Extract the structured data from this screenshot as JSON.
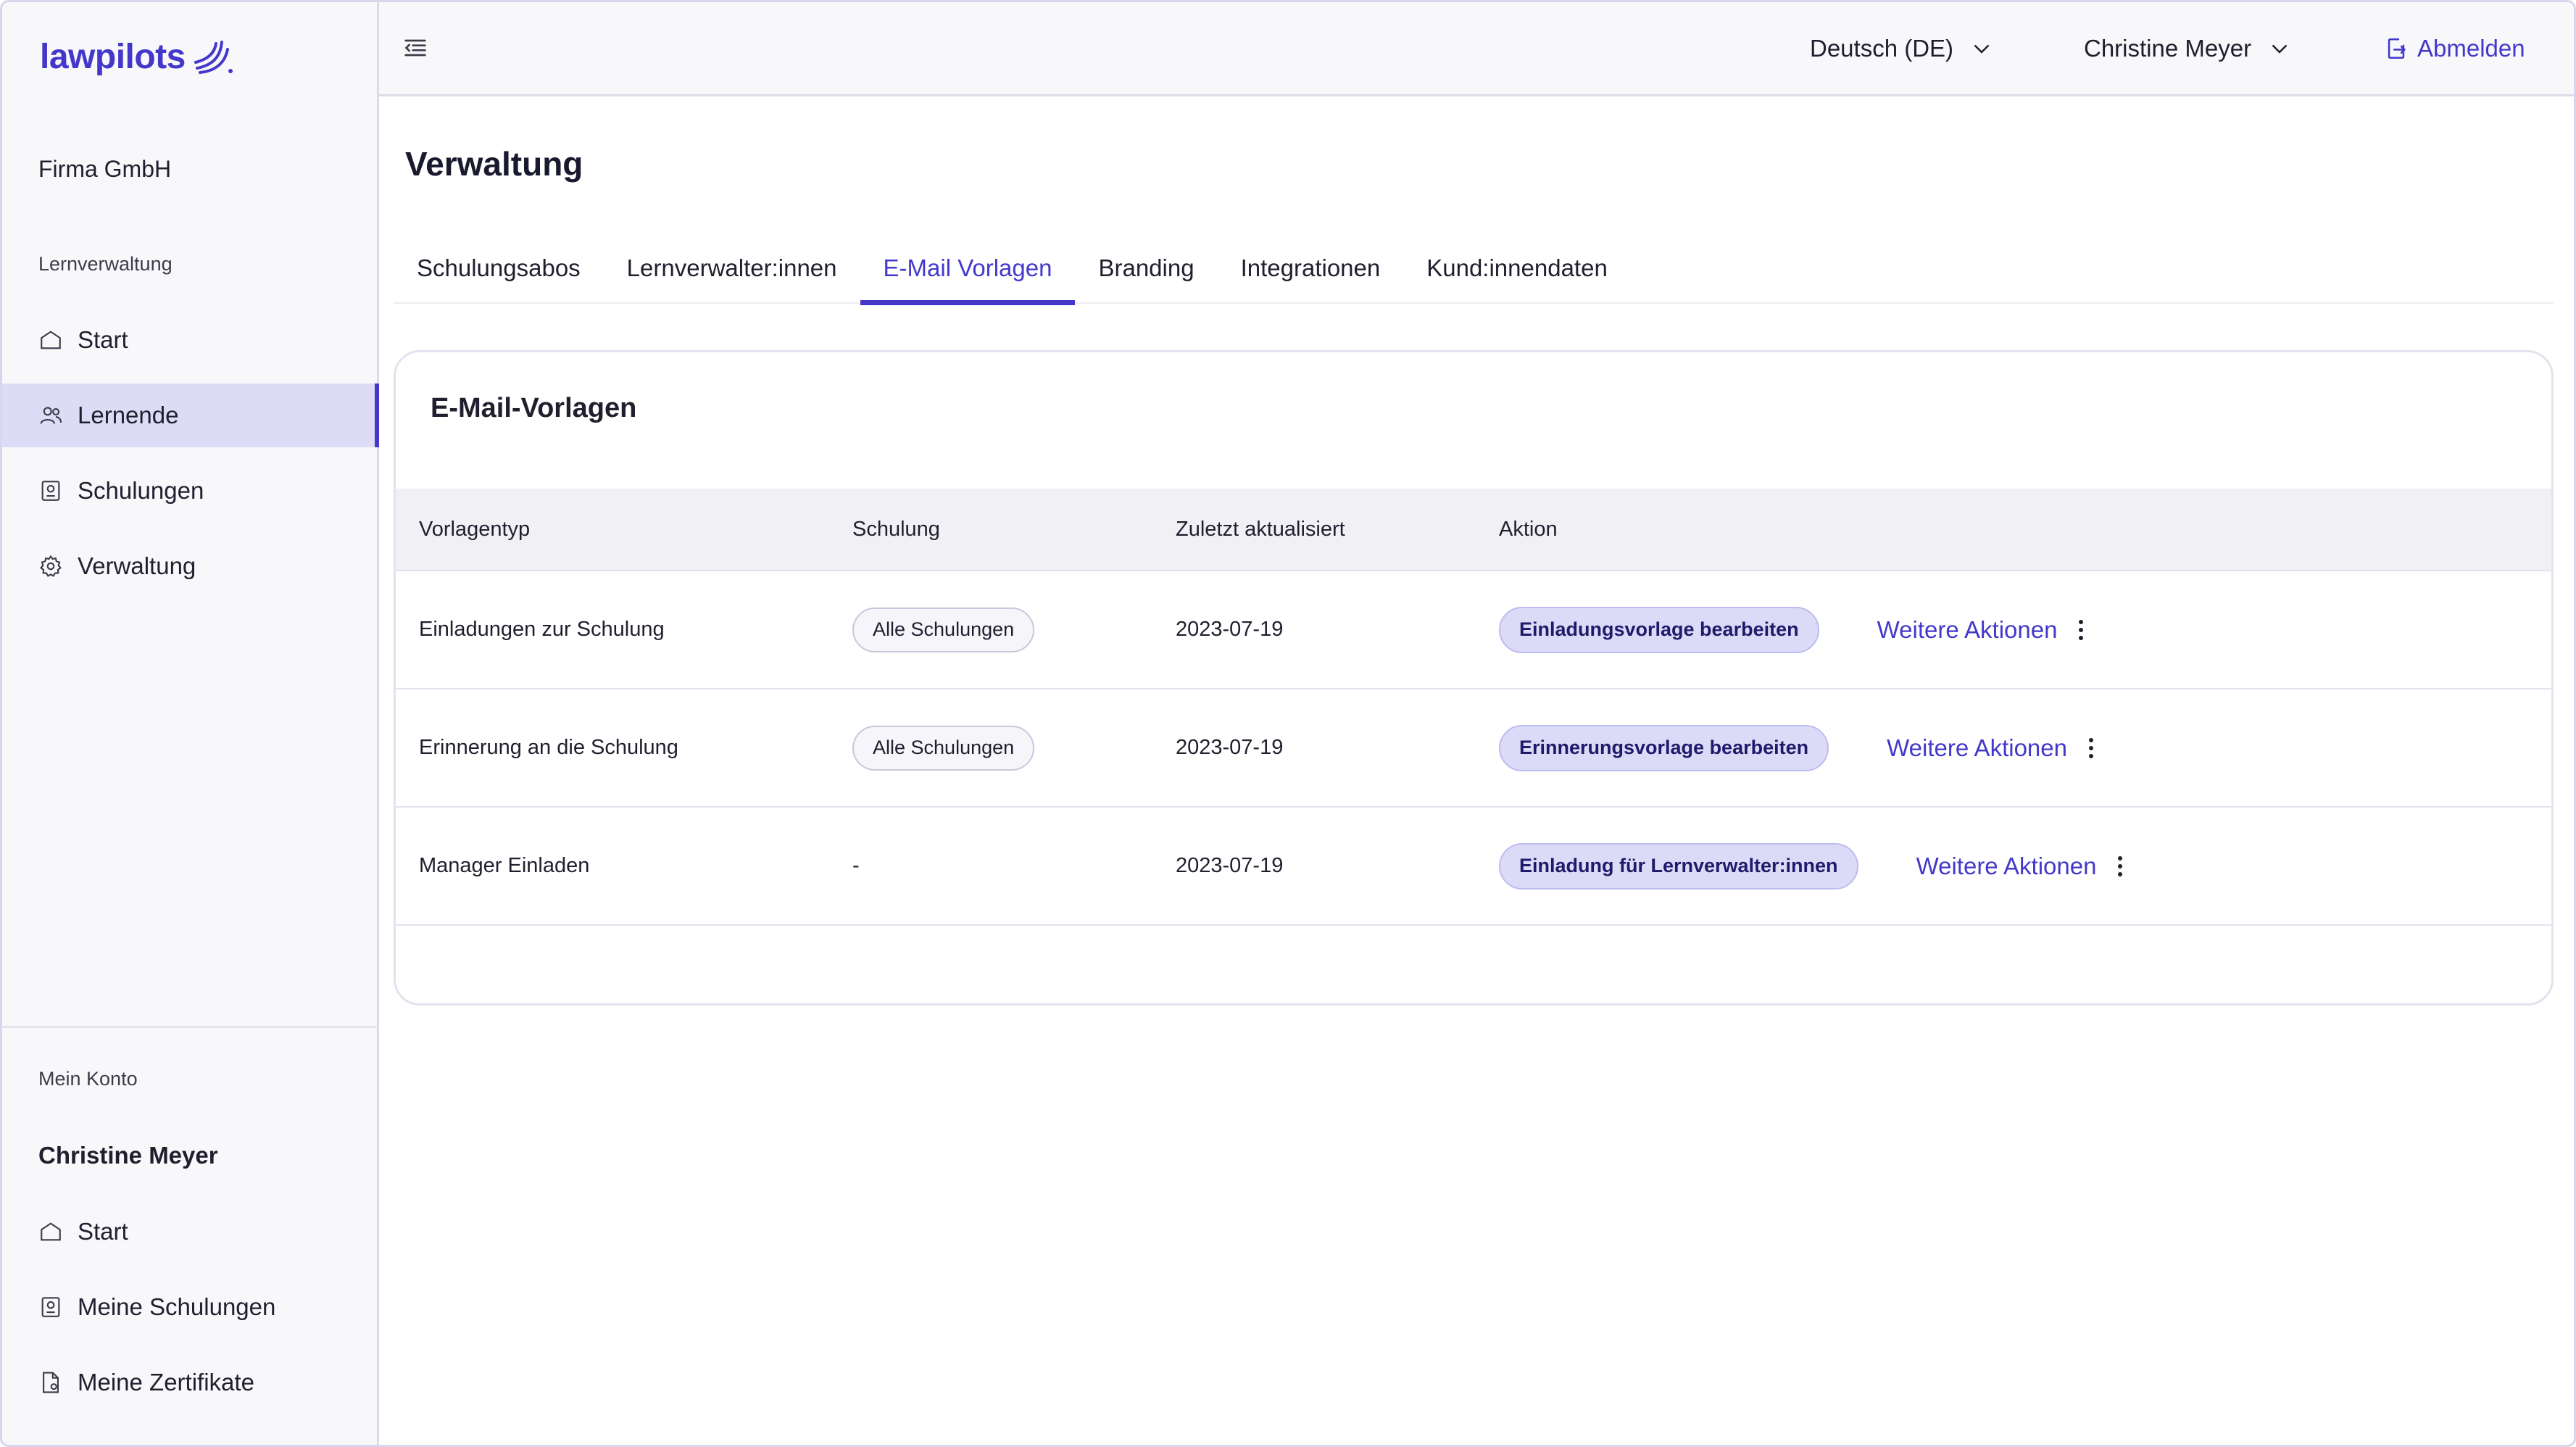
{
  "brand": {
    "name": "lawpilots",
    "accent": "#4338ca"
  },
  "sidebar": {
    "company": "Firma GmbH",
    "admin_section": "Lernverwaltung",
    "admin_items": [
      {
        "label": "Start",
        "icon": "home-icon"
      },
      {
        "label": "Lernende",
        "icon": "users-icon",
        "active": true
      },
      {
        "label": "Schulungen",
        "icon": "course-icon"
      },
      {
        "label": "Verwaltung",
        "icon": "gear-icon"
      }
    ],
    "account_section": "Mein Konto",
    "account_name": "Christine Meyer",
    "account_items": [
      {
        "label": "Start",
        "icon": "home-icon"
      },
      {
        "label": "Meine Schulungen",
        "icon": "course-icon"
      },
      {
        "label": "Meine Zertifikate",
        "icon": "certificate-icon"
      }
    ]
  },
  "header": {
    "language": "Deutsch (DE)",
    "user": "Christine Meyer",
    "logout": "Abmelden"
  },
  "main": {
    "title": "Verwaltung",
    "tabs": [
      {
        "label": "Schulungsabos"
      },
      {
        "label": "Lernverwalter:innen"
      },
      {
        "label": "E-Mail Vorlagen",
        "active": true
      },
      {
        "label": "Branding"
      },
      {
        "label": "Integrationen"
      },
      {
        "label": "Kund:innendaten"
      }
    ],
    "card_title": "E-Mail-Vorlagen",
    "table": {
      "columns": [
        "Vorlagentyp",
        "Schulung",
        "Zuletzt aktualisiert",
        "Aktion"
      ],
      "rows": [
        {
          "type": "Einladungen zur Schulung",
          "course": "Alle Schulungen",
          "updated": "2023-07-19",
          "action": "Einladungsvorlage bearbeiten",
          "more": "Weitere Aktionen"
        },
        {
          "type": "Erinnerung an die Schulung",
          "course": "Alle Schulungen",
          "updated": "2023-07-19",
          "action": "Erinnerungsvorlage bearbeiten",
          "more": "Weitere Aktionen"
        },
        {
          "type": "Manager Einladen",
          "course": "-",
          "updated": "2023-07-19",
          "action": "Einladung für Lernverwalter:innen",
          "more": "Weitere Aktionen"
        }
      ]
    }
  }
}
